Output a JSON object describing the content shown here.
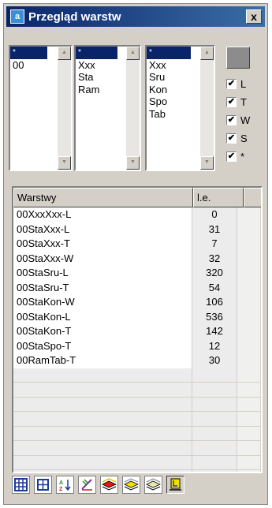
{
  "window": {
    "title": "Przegląd warstw",
    "close_label": "x",
    "app_icon_glyph": "a"
  },
  "lists": [
    {
      "name": "list-1",
      "items": [
        "*",
        "00"
      ]
    },
    {
      "name": "list-2",
      "items": [
        "*",
        "Xxx",
        "Sta",
        "Ram"
      ]
    },
    {
      "name": "list-3",
      "items": [
        "*",
        "Xxx",
        "Sru",
        "Kon",
        "Spo",
        "Tab"
      ]
    }
  ],
  "checkboxes": [
    {
      "label": "L",
      "checked": true
    },
    {
      "label": "T",
      "checked": true
    },
    {
      "label": "W",
      "checked": true
    },
    {
      "label": "S",
      "checked": true
    },
    {
      "label": "*",
      "checked": true
    }
  ],
  "table": {
    "columns": [
      "Warstwy",
      "l.e."
    ],
    "rows": [
      {
        "name": "00XxxXxx-L",
        "count": "0"
      },
      {
        "name": "00StaXxx-L",
        "count": "31"
      },
      {
        "name": "00StaXxx-T",
        "count": "7"
      },
      {
        "name": "00StaXxx-W",
        "count": "32"
      },
      {
        "name": "00StaSru-L",
        "count": "320"
      },
      {
        "name": "00StaSru-T",
        "count": "54"
      },
      {
        "name": "00StaKon-W",
        "count": "106"
      },
      {
        "name": "00StaKon-L",
        "count": "536"
      },
      {
        "name": "00StaKon-T",
        "count": "142"
      },
      {
        "name": "00StaSpo-T",
        "count": "12"
      },
      {
        "name": "00RamTab-T",
        "count": "30"
      }
    ]
  },
  "toolbar": {
    "buttons": [
      {
        "icon": "grid-icon"
      },
      {
        "icon": "grid-small-icon"
      },
      {
        "icon": "sort-icon"
      },
      {
        "icon": "edit-layers-icon"
      },
      {
        "icon": "layer-red-icon"
      },
      {
        "icon": "layer-yellow-icon"
      },
      {
        "icon": "layer-plain-icon"
      },
      {
        "icon": "export-layer-icon"
      }
    ]
  },
  "colors": {
    "title_bar_start": "#0a246a",
    "title_bar_end": "#3a6ea5",
    "selection": "#0a246a",
    "window_bg": "#d4d0c8"
  }
}
